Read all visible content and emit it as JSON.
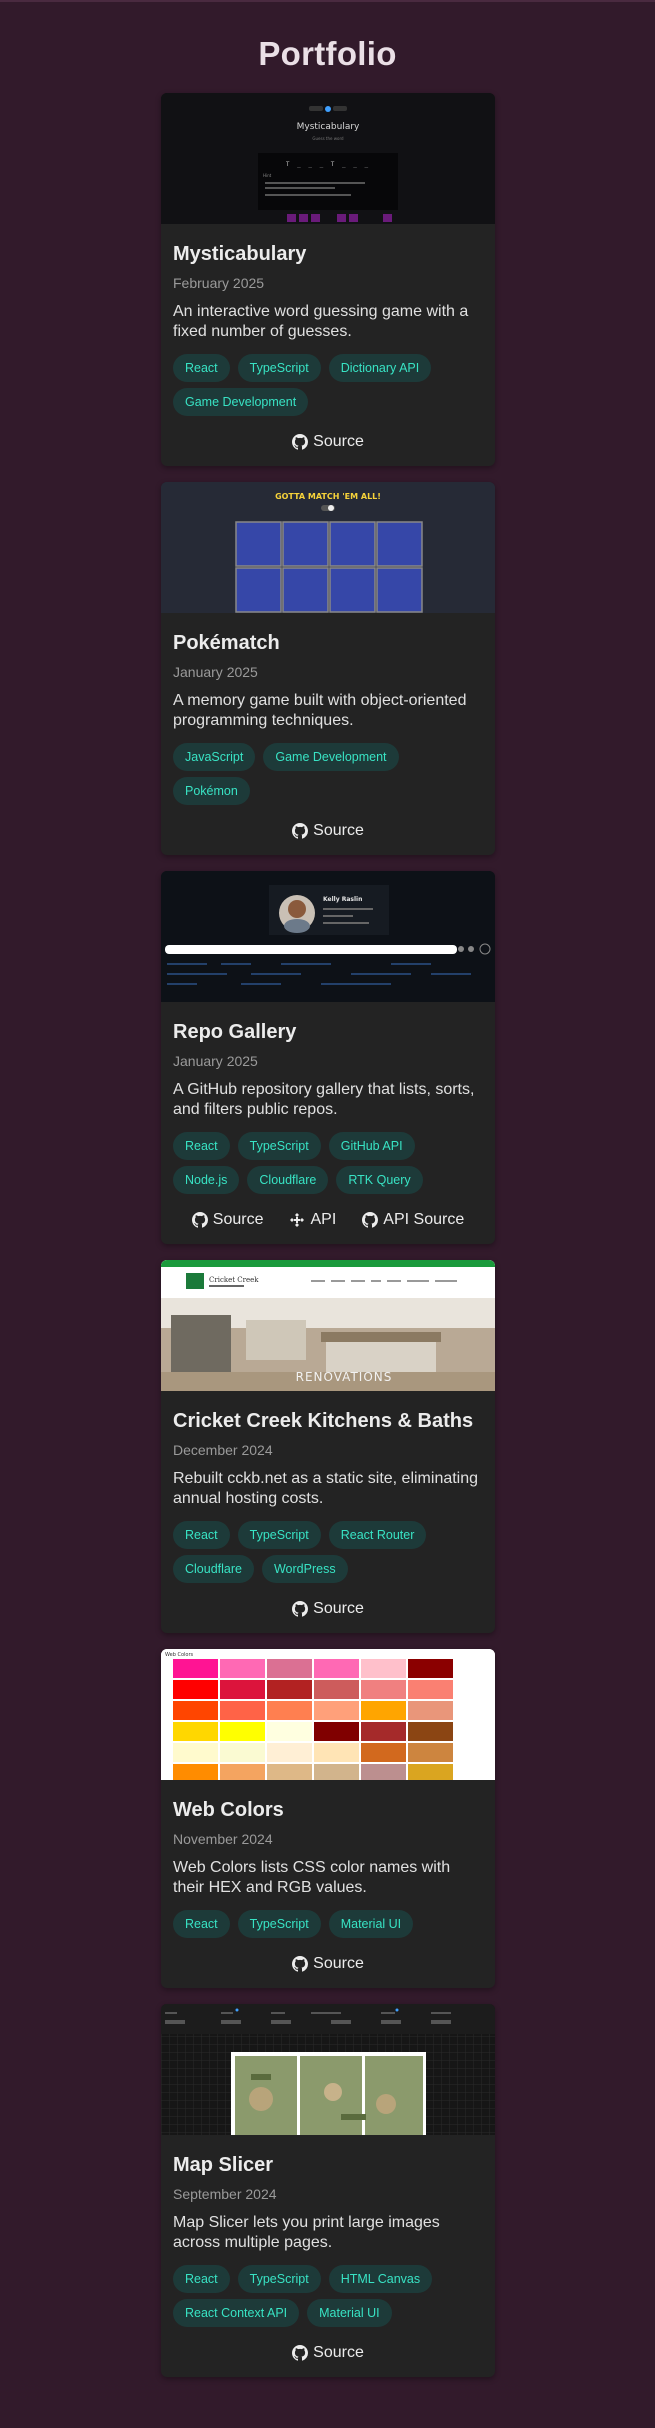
{
  "page": {
    "title": "Portfolio"
  },
  "projects": [
    {
      "title": "Mysticabulary",
      "date": "February 2025",
      "description": "An interactive word guessing game with a fixed number of guesses.",
      "tags": [
        "React",
        "TypeScript",
        "Dictionary API",
        "Game Development"
      ],
      "links": [
        {
          "label": "Source",
          "icon": "github-icon"
        }
      ],
      "thumb": {
        "title": "Mysticabulary",
        "letters": "T _ _ _ T _ _ _",
        "keys": [
          "a",
          "b",
          "c",
          "d",
          "e",
          "f"
        ]
      }
    },
    {
      "title": "Pokématch",
      "date": "January 2025",
      "description": "A memory game built with object-oriented programming techniques.",
      "tags": [
        "JavaScript",
        "Game Development",
        "Pokémon"
      ],
      "links": [
        {
          "label": "Source",
          "icon": "github-icon"
        }
      ],
      "thumb": {
        "banner": "GOTTA MATCH 'EM ALL!"
      }
    },
    {
      "title": "Repo Gallery",
      "date": "January 2025",
      "description": "A GitHub repository gallery that lists, sorts, and filters public repos.",
      "tags": [
        "React",
        "TypeScript",
        "GitHub API",
        "Node.js",
        "Cloudflare",
        "RTK Query"
      ],
      "links": [
        {
          "label": "Source",
          "icon": "github-icon"
        },
        {
          "label": "API",
          "icon": "api-icon"
        },
        {
          "label": "API Source",
          "icon": "github-icon"
        }
      ],
      "thumb": {
        "name": "Kelly Raslin"
      }
    },
    {
      "title": "Cricket Creek Kitchens & Baths",
      "date": "December 2024",
      "description": "Rebuilt cckb.net as a static site, eliminating annual hosting costs.",
      "tags": [
        "React",
        "TypeScript",
        "React Router",
        "Cloudflare",
        "WordPress"
      ],
      "links": [
        {
          "label": "Source",
          "icon": "github-icon"
        }
      ],
      "thumb": {
        "brand": "Cricket Creek",
        "hero": "RENOVATIONS"
      }
    },
    {
      "title": "Web Colors",
      "date": "November 2024",
      "description": "Web Colors lists CSS color names with their HEX and RGB values.",
      "tags": [
        "React",
        "TypeScript",
        "Material UI"
      ],
      "links": [
        {
          "label": "Source",
          "icon": "github-icon"
        }
      ],
      "thumb": {
        "header": "Web Colors"
      }
    },
    {
      "title": "Map Slicer",
      "date": "September 2024",
      "description": "Map Slicer lets you print large images across multiple pages.",
      "tags": [
        "React",
        "TypeScript",
        "HTML Canvas",
        "React Context API",
        "Material UI"
      ],
      "links": [
        {
          "label": "Source",
          "icon": "github-icon"
        }
      ],
      "thumb": {}
    }
  ],
  "colors": {
    "background": "#321a2b",
    "card": "#232323",
    "tag_bg": "#1d3a39",
    "tag_text": "#38e3c4"
  }
}
